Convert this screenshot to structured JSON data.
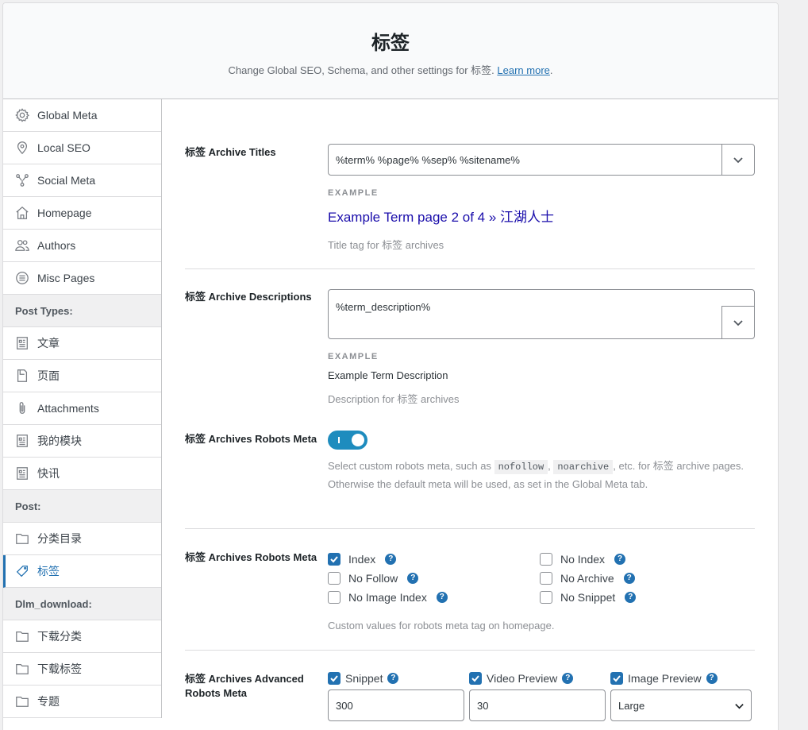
{
  "header": {
    "title": "标签",
    "subtitle": "Change Global SEO, Schema, and other settings for 标签.",
    "learn_more": "Learn more",
    "period": "."
  },
  "sidebar": {
    "items": [
      {
        "label": "Global Meta",
        "icon": "gear-icon"
      },
      {
        "label": "Local SEO",
        "icon": "location-icon"
      },
      {
        "label": "Social Meta",
        "icon": "share-icon"
      },
      {
        "label": "Homepage",
        "icon": "home-icon"
      },
      {
        "label": "Authors",
        "icon": "users-icon"
      },
      {
        "label": "Misc Pages",
        "icon": "menu-circle-icon"
      }
    ],
    "post_types_heading": "Post Types:",
    "post_types": [
      {
        "label": "文章",
        "icon": "document-icon"
      },
      {
        "label": "页面",
        "icon": "page-icon"
      },
      {
        "label": "Attachments",
        "icon": "paperclip-icon"
      },
      {
        "label": "我的模块",
        "icon": "document-icon"
      },
      {
        "label": "快讯",
        "icon": "document-icon"
      }
    ],
    "post_heading": "Post:",
    "post": [
      {
        "label": "分类目录",
        "icon": "folder-icon"
      },
      {
        "label": "标签",
        "icon": "tag-icon",
        "active": true
      }
    ],
    "dlm_heading": "Dlm_download:",
    "dlm": [
      {
        "label": "下载分类",
        "icon": "folder-icon"
      },
      {
        "label": "下载标签",
        "icon": "folder-icon"
      },
      {
        "label": "专题",
        "icon": "folder-icon"
      }
    ]
  },
  "titles": {
    "label": "标签 Archive Titles",
    "value": "%term% %page% %sep% %sitename%",
    "example_label": "EXAMPLE",
    "example": "Example Term page 2 of 4 » 江湖人士",
    "help": "Title tag for 标签 archives"
  },
  "descriptions": {
    "label": "标签 Archive Descriptions",
    "value": "%term_description%",
    "example_label": "EXAMPLE",
    "example": "Example Term Description",
    "help": "Description for 标签 archives"
  },
  "robots_toggle": {
    "label": "标签 Archives Robots Meta",
    "help_pre": "Select custom robots meta, such as",
    "code1": "nofollow",
    "comma": ",",
    "code2": "noarchive",
    "help_post": ", etc. for 标签 archive pages. Otherwise the default meta will be used, as set in the Global Meta tab.",
    "enabled": true
  },
  "robots_meta": {
    "label": "标签 Archives Robots Meta",
    "options": [
      {
        "label": "Index",
        "checked": true
      },
      {
        "label": "No Index",
        "checked": false
      },
      {
        "label": "No Follow",
        "checked": false
      },
      {
        "label": "No Archive",
        "checked": false
      },
      {
        "label": "No Image Index",
        "checked": false
      },
      {
        "label": "No Snippet",
        "checked": false
      }
    ],
    "help": "Custom values for robots meta tag on homepage."
  },
  "advanced": {
    "label": "标签 Archives Advanced Robots Meta",
    "snippet_label": "Snippet",
    "snippet_value": "300",
    "video_label": "Video Preview",
    "video_value": "30",
    "image_label": "Image Preview",
    "image_value": "Large"
  },
  "colors": {
    "accent": "#2271b1",
    "toggle": "#1e8cbe",
    "example_link": "#1a0dab"
  }
}
